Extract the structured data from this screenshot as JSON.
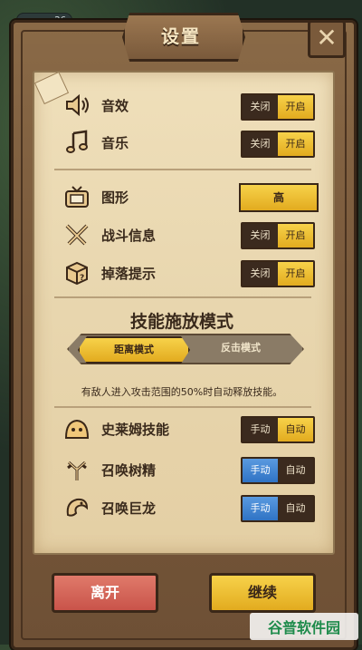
{
  "hud": {
    "level": "26"
  },
  "header": {
    "title": "设置",
    "close_icon": "close-icon"
  },
  "settings": {
    "sound": {
      "label": "音效",
      "off": "关闭",
      "on": "开启",
      "state": "on"
    },
    "music": {
      "label": "音乐",
      "off": "关闭",
      "on": "开启",
      "state": "on"
    },
    "graphics": {
      "label": "图形",
      "value": "高"
    },
    "battle_info": {
      "label": "战斗信息",
      "off": "关闭",
      "on": "开启",
      "state": "on"
    },
    "drop_hint": {
      "label": "掉落提示",
      "off": "关闭",
      "on": "开启",
      "state": "on"
    }
  },
  "skill_mode": {
    "title": "技能施放模式",
    "tabs": [
      {
        "label": "距离模式",
        "selected": true
      },
      {
        "label": "反击模式",
        "selected": false
      }
    ],
    "description": "有敌人进入攻击范围的50%时自动释放技能。"
  },
  "skills": [
    {
      "label": "史莱姆技能",
      "manual": "手动",
      "auto": "自动",
      "state": "auto"
    },
    {
      "label": "召唤树精",
      "manual": "手动",
      "auto": "自动",
      "state": "manual"
    },
    {
      "label": "召唤巨龙",
      "manual": "手动",
      "auto": "自动",
      "state": "manual"
    }
  ],
  "footer": {
    "leave": "离开",
    "continue": "继续"
  },
  "watermark": {
    "text": "谷普软件园"
  },
  "colors": {
    "accent_yellow": "#e2ab1f",
    "manual_blue": "#2f73c4",
    "leave_red": "#c9544a",
    "parchment": "#e8d6ae",
    "wood": "#7a5a3c"
  }
}
